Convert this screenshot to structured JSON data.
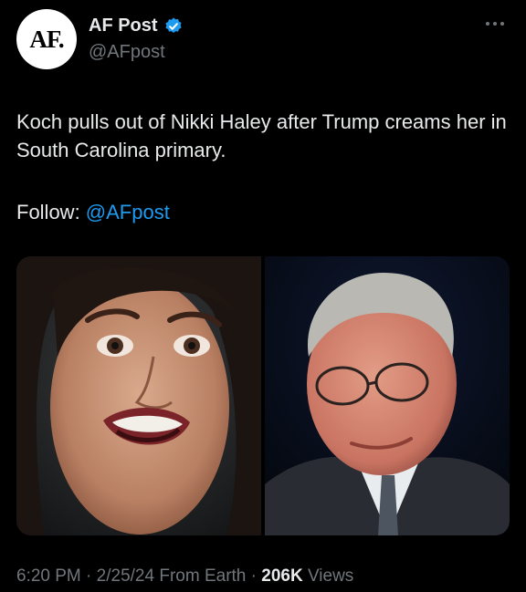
{
  "author": {
    "avatar_text": "AF.",
    "name": "AF Post",
    "handle": "@AFpost"
  },
  "tweet": {
    "text": "Koch pulls out of Nikki Haley after Trump creams her in South Carolina primary.",
    "follow_label": "Follow: ",
    "follow_link": "@AFpost"
  },
  "media": {
    "left_photo": "photo of a woman speaking",
    "right_photo": "photo of an older man with glasses"
  },
  "meta": {
    "time": "6:20 PM",
    "date": "2/25/24",
    "source": "From Earth",
    "views_count": "206K",
    "views_label": "Views",
    "sep": "·"
  },
  "colors": {
    "background": "#000000",
    "text": "#e7e9ea",
    "muted": "#71767b",
    "link": "#1d9bf0",
    "verified": "#1d9bf0"
  },
  "icons": {
    "verified": "verified-badge-icon",
    "more": "more-options-icon"
  }
}
